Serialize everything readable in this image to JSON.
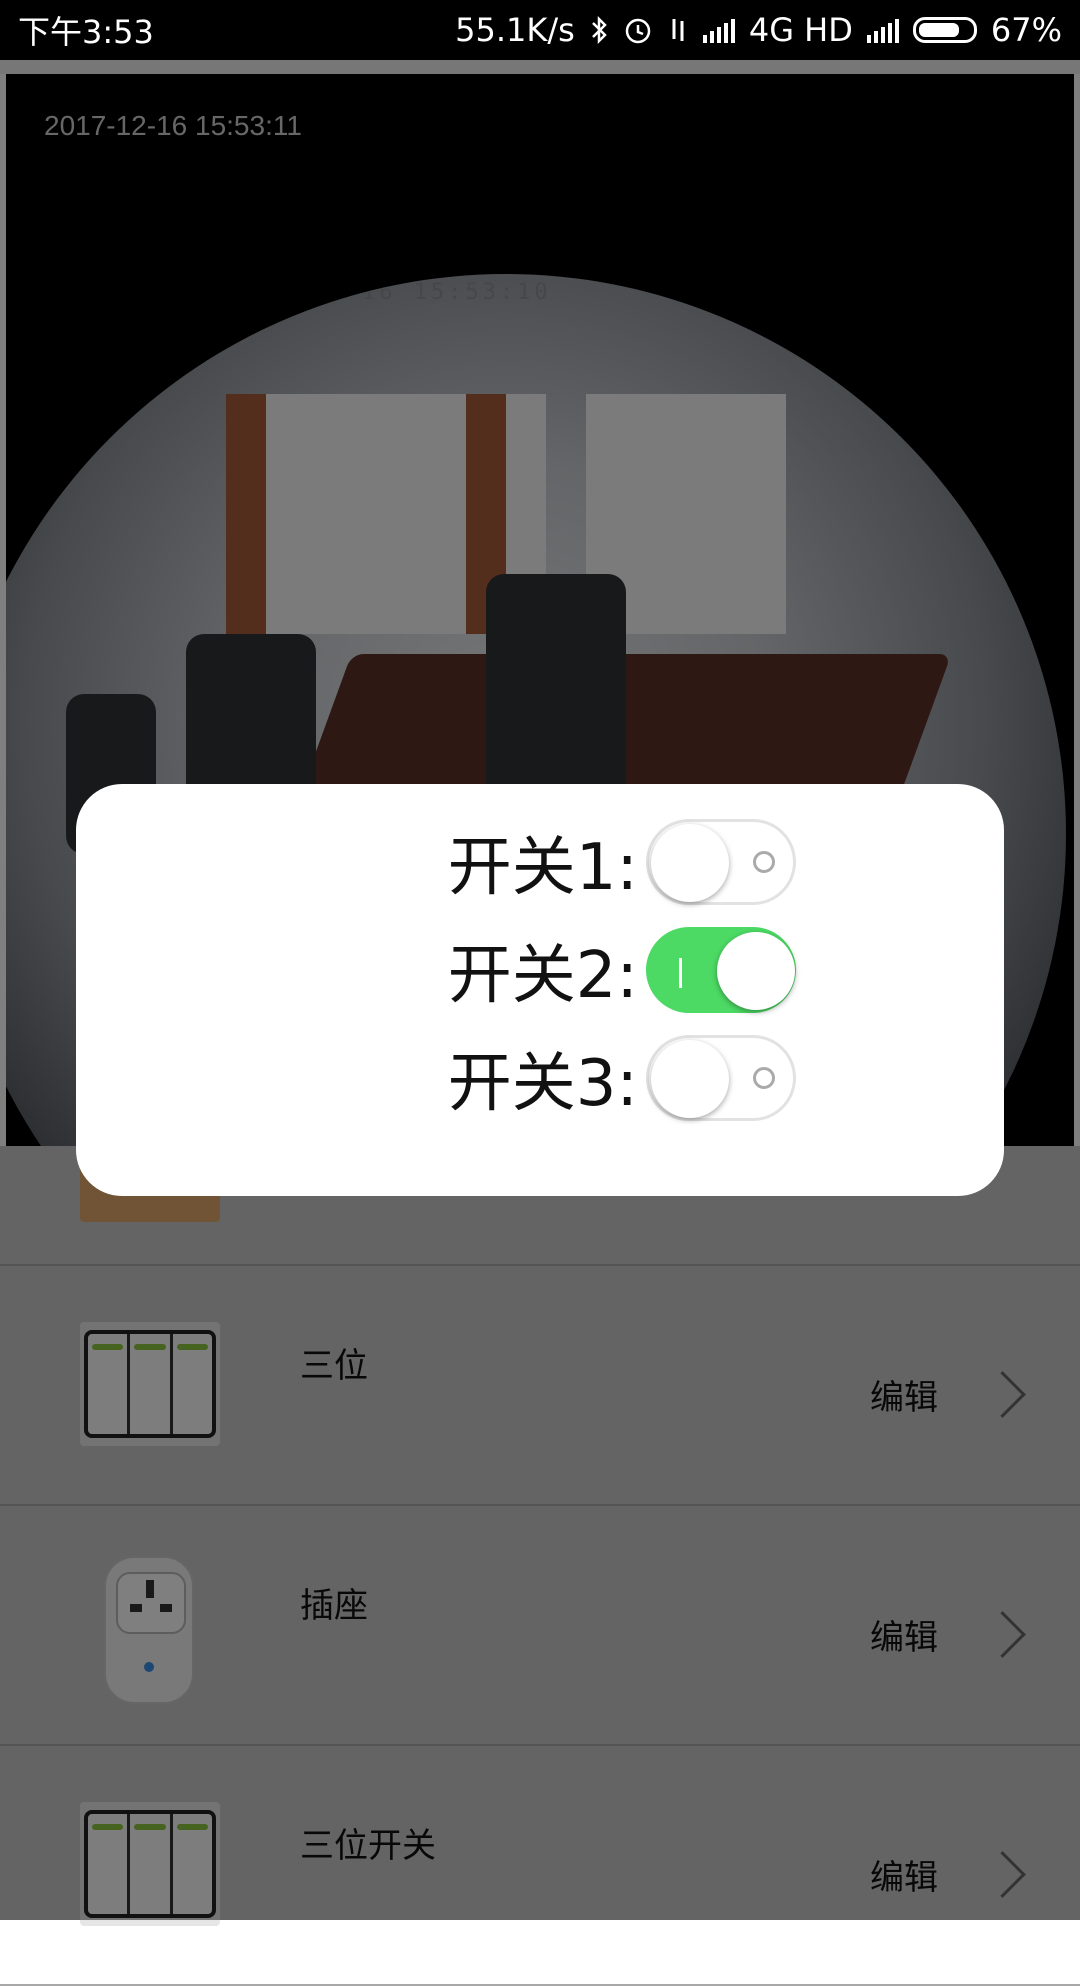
{
  "status_bar": {
    "time": "下午3:53",
    "speed": "55.1K/s",
    "network": "4G HD",
    "battery": "67%"
  },
  "camera": {
    "timestamp_overlay": "2017-12-16 15:53:11",
    "fisheye_timestamp": "2017-12-16 15:53:10"
  },
  "dialog": {
    "switches": [
      {
        "label": "开关1:",
        "on": false
      },
      {
        "label": "开关2:",
        "on": true
      },
      {
        "label": "开关3:",
        "on": false
      }
    ]
  },
  "devices": [
    {
      "name": "三位",
      "edit": "编辑",
      "icon": "three-gang-switch-icon"
    },
    {
      "name": "插座",
      "edit": "编辑",
      "icon": "socket-icon"
    },
    {
      "name": "三位开关",
      "edit": "编辑",
      "icon": "three-gang-switch-icon"
    }
  ]
}
